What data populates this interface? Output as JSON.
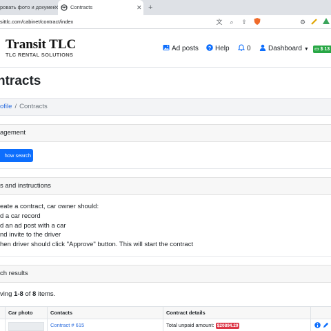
{
  "browser": {
    "tabs": [
      {
        "label": "ровать фото и документ",
        "active": false
      },
      {
        "label": "Contracts",
        "active": true
      }
    ],
    "new_tab_glyph": "+",
    "url": "sittlc.com/cabinet/contract/index"
  },
  "navbar": {
    "brand": "Transit TLC",
    "brand_sub": "TLC RENTAL SOLUTIONS",
    "ad_posts": "Ad posts",
    "help": "Help",
    "notifications_count": "0",
    "dashboard": "Dashboard",
    "balance": "$ 13"
  },
  "page": {
    "title": "ntracts",
    "breadcrumb": {
      "link": "ofile",
      "separator": "/",
      "current": "Contracts"
    },
    "management_title": "agement",
    "show_search": "how search",
    "instructions_title": "s and instructions",
    "instructions": [
      "eate a contract, car owner should:",
      "d a car record",
      "d an ad post with a car",
      "nd invite to the driver",
      "hen driver should click \"Approve\" button. This will start the contract"
    ],
    "results_title": "ch results",
    "summary": {
      "prefix": "ving ",
      "range": "1-8",
      "mid": " of ",
      "total": "8",
      "suffix": " items."
    }
  },
  "table": {
    "headers": [
      "Car photo",
      "Contacts",
      "Contract details"
    ],
    "rows": [
      {
        "contact": "Contract # 615",
        "details_label": "Total unpaid amount:",
        "amount": "$20894.29"
      }
    ]
  },
  "colors": {
    "primary": "#0d6efd",
    "link": "#2f6fde",
    "success": "#28a745",
    "danger": "#dc3545"
  }
}
